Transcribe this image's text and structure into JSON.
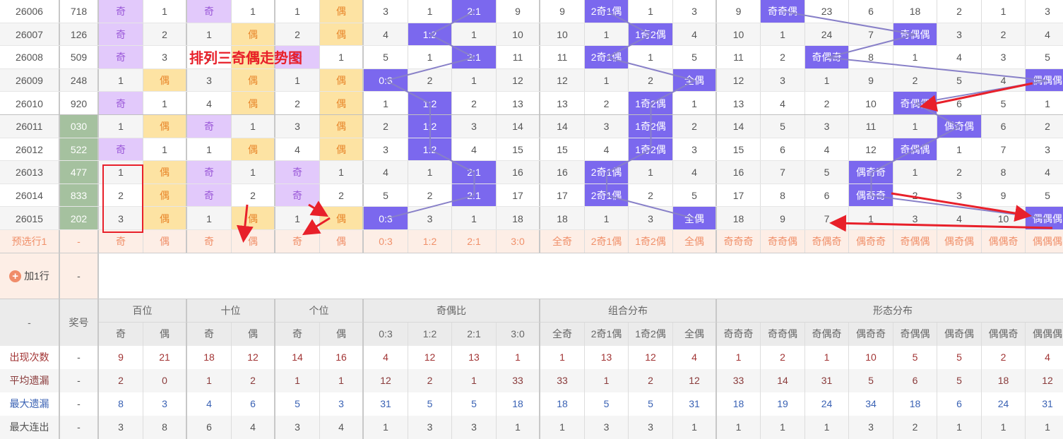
{
  "annotation_title": "排列三奇偶走势图",
  "colors": {
    "hit_blue": "#7b68ee",
    "odd_bg": "#e2c9fb",
    "even_bg": "#fde3a3",
    "number_green": "#a5c19f",
    "line": "#8880c8",
    "arrow": "#e8202a"
  },
  "draws": [
    {
      "issue": "26006",
      "number": "718",
      "cells": [
        "奇",
        "1",
        "奇",
        "1",
        "1",
        "偶",
        "3",
        "1",
        "2:1",
        "9",
        "9",
        "2奇1偶",
        "1",
        "3",
        "9",
        "奇奇偶",
        "23",
        "6",
        "18",
        "2",
        "1",
        "3"
      ]
    },
    {
      "issue": "26007",
      "number": "126",
      "cells": [
        "奇",
        "2",
        "1",
        "偶",
        "2",
        "偶",
        "4",
        "1:2",
        "1",
        "10",
        "10",
        "1",
        "1奇2偶",
        "4",
        "10",
        "1",
        "24",
        "7",
        "奇偶偶",
        "3",
        "2",
        "4"
      ]
    },
    {
      "issue": "26008",
      "number": "509",
      "cells": [
        "奇",
        "3",
        "2",
        "偶",
        "奇",
        "1",
        "5",
        "1",
        "2:1",
        "11",
        "11",
        "2奇1偶",
        "1",
        "5",
        "11",
        "2",
        "奇偶奇",
        "8",
        "1",
        "4",
        "3",
        "5"
      ]
    },
    {
      "issue": "26009",
      "number": "248",
      "cells": [
        "1",
        "偶",
        "3",
        "偶",
        "1",
        "偶",
        "0:3",
        "2",
        "1",
        "12",
        "12",
        "1",
        "2",
        "全偶",
        "12",
        "3",
        "1",
        "9",
        "2",
        "5",
        "4",
        "偶偶偶"
      ]
    },
    {
      "issue": "26010",
      "number": "920",
      "cells": [
        "奇",
        "1",
        "4",
        "偶",
        "2",
        "偶",
        "1",
        "1:2",
        "2",
        "13",
        "13",
        "2",
        "1奇2偶",
        "1",
        "13",
        "4",
        "2",
        "10",
        "奇偶偶",
        "6",
        "5",
        "1"
      ]
    },
    {
      "issue": "26011",
      "number": "030",
      "cells": [
        "1",
        "偶",
        "奇",
        "1",
        "3",
        "偶",
        "2",
        "1:2",
        "3",
        "14",
        "14",
        "3",
        "1奇2偶",
        "2",
        "14",
        "5",
        "3",
        "11",
        "1",
        "偶奇偶",
        "6",
        "2"
      ]
    },
    {
      "issue": "26012",
      "number": "522",
      "cells": [
        "奇",
        "1",
        "1",
        "偶",
        "4",
        "偶",
        "3",
        "1:2",
        "4",
        "15",
        "15",
        "4",
        "1奇2偶",
        "3",
        "15",
        "6",
        "4",
        "12",
        "奇偶偶",
        "1",
        "7",
        "3"
      ]
    },
    {
      "issue": "26013",
      "number": "477",
      "cells": [
        "1",
        "偶",
        "奇",
        "1",
        "奇",
        "1",
        "4",
        "1",
        "2:1",
        "16",
        "16",
        "2奇1偶",
        "1",
        "4",
        "16",
        "7",
        "5",
        "偶奇奇",
        "1",
        "2",
        "8",
        "4"
      ]
    },
    {
      "issue": "26014",
      "number": "833",
      "cells": [
        "2",
        "偶",
        "奇",
        "2",
        "奇",
        "2",
        "5",
        "2",
        "2:1",
        "17",
        "17",
        "2奇1偶",
        "2",
        "5",
        "17",
        "8",
        "6",
        "偶奇奇",
        "2",
        "3",
        "9",
        "5"
      ]
    },
    {
      "issue": "26015",
      "number": "202",
      "cells": [
        "3",
        "偶",
        "1",
        "偶",
        "1",
        "偶",
        "0:3",
        "3",
        "1",
        "18",
        "18",
        "1",
        "3",
        "全偶",
        "18",
        "9",
        "7",
        "1",
        "3",
        "4",
        "10",
        "偶偶偶"
      ]
    }
  ],
  "preselect": {
    "label": "预选行1",
    "number": "-",
    "cells": [
      "奇",
      "偶",
      "奇",
      "偶",
      "奇",
      "偶",
      "0:3",
      "1:2",
      "2:1",
      "3:0",
      "全奇",
      "2奇1偶",
      "1奇2偶",
      "全偶",
      "奇奇奇",
      "奇奇偶",
      "奇偶奇",
      "偶奇奇",
      "奇偶偶",
      "偶奇偶",
      "偶偶奇",
      "偶偶偶"
    ]
  },
  "add_row": {
    "label": "加1行",
    "number": "-"
  },
  "header": {
    "corner": "-",
    "number": "奖号",
    "groups": [
      "百位",
      "十位",
      "个位",
      "奇偶比",
      "组合分布",
      "形态分布"
    ],
    "subs": [
      "奇",
      "偶",
      "奇",
      "偶",
      "奇",
      "偶",
      "0:3",
      "1:2",
      "2:1",
      "3:0",
      "全奇",
      "2奇1偶",
      "1奇2偶",
      "全偶",
      "奇奇奇",
      "奇奇偶",
      "奇偶奇",
      "偶奇奇",
      "奇偶偶",
      "偶奇偶",
      "偶偶奇",
      "偶偶偶"
    ]
  },
  "stats": [
    {
      "label": "出现次数",
      "number": "-",
      "color": "#a23434",
      "values": [
        "9",
        "21",
        "18",
        "12",
        "14",
        "16",
        "4",
        "12",
        "13",
        "1",
        "1",
        "13",
        "12",
        "4",
        "1",
        "2",
        "1",
        "10",
        "5",
        "5",
        "2",
        "4"
      ]
    },
    {
      "label": "平均遗漏",
      "number": "-",
      "color": "#8a3b3b",
      "values": [
        "2",
        "0",
        "1",
        "2",
        "1",
        "1",
        "12",
        "2",
        "1",
        "33",
        "33",
        "1",
        "2",
        "12",
        "33",
        "14",
        "31",
        "5",
        "6",
        "5",
        "18",
        "12"
      ]
    },
    {
      "label": "最大遗漏",
      "number": "-",
      "color": "#3a62b4",
      "values": [
        "8",
        "3",
        "4",
        "6",
        "5",
        "3",
        "31",
        "5",
        "5",
        "18",
        "18",
        "5",
        "5",
        "31",
        "18",
        "19",
        "24",
        "34",
        "18",
        "6",
        "24",
        "31"
      ]
    },
    {
      "label": "最大连出",
      "number": "-",
      "color": "#555555",
      "values": [
        "3",
        "8",
        "6",
        "4",
        "3",
        "4",
        "1",
        "3",
        "3",
        "1",
        "1",
        "3",
        "3",
        "1",
        "1",
        "1",
        "1",
        "3",
        "2",
        "1",
        "1",
        "1"
      ]
    }
  ]
}
